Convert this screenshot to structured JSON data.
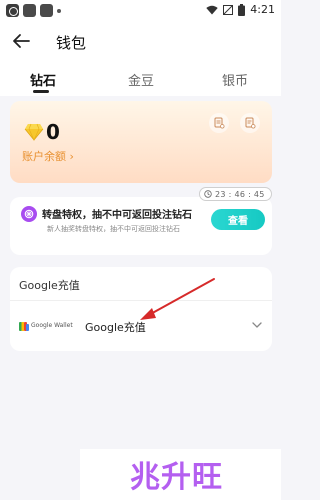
{
  "status_bar": {
    "time": "4:21"
  },
  "header": {
    "title": "钱包"
  },
  "tabs": [
    {
      "label": "钻石",
      "active": true
    },
    {
      "label": "金豆",
      "active": false
    },
    {
      "label": "银币",
      "active": false
    }
  ],
  "balance": {
    "amount": "0",
    "label": "账户余额 ›"
  },
  "promo": {
    "title": "转盘特权，抽不中可返回投注钻石",
    "subtitle": "新人抽奖转盘特权，抽不中可返回投注钻石",
    "timer": "23 : 46 : 45",
    "button_label": "查看"
  },
  "payment": {
    "section_title": "Google充值",
    "wallet_label": "Google Wallet",
    "method_label": "Google充值"
  },
  "watermark": "兆升旺",
  "colors": {
    "accent_teal": "#16c9c3",
    "balance_orange": "#e8902f",
    "promo_purple": "#a84cf0",
    "arrow_red": "#d62a2a"
  }
}
